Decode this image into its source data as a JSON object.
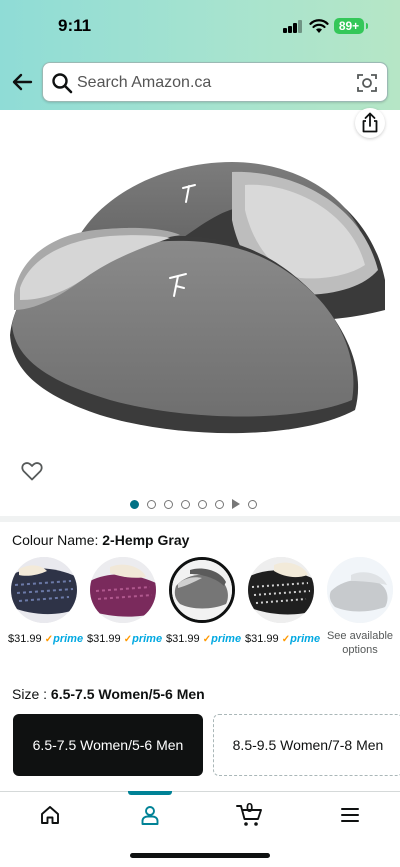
{
  "status_bar": {
    "time": "9:11",
    "battery": "89+"
  },
  "search": {
    "placeholder": "Search Amazon.ca"
  },
  "colour": {
    "label": "Colour Name: ",
    "value": "2-Hemp Gray"
  },
  "swatches": [
    {
      "price": "$31.99",
      "prime": "prime"
    },
    {
      "price": "$31.99",
      "prime": "prime"
    },
    {
      "price": "$31.99",
      "prime": "prime"
    },
    {
      "price": "$31.99",
      "prime": "prime"
    },
    {
      "line1": "See available",
      "line2": "options"
    }
  ],
  "size": {
    "label": "Size : ",
    "value": "6.5-7.5 Women/5-6 Men"
  },
  "size_options": [
    "6.5-7.5 Women/5-6 Men",
    "8.5-9.5 Women/7-8 Men"
  ],
  "nav": {
    "cart_count": "0"
  },
  "colors": {
    "accent": "#007185",
    "prime": "#00a8e1",
    "selected_button": "#0f1111",
    "active_tab": "#008296"
  }
}
